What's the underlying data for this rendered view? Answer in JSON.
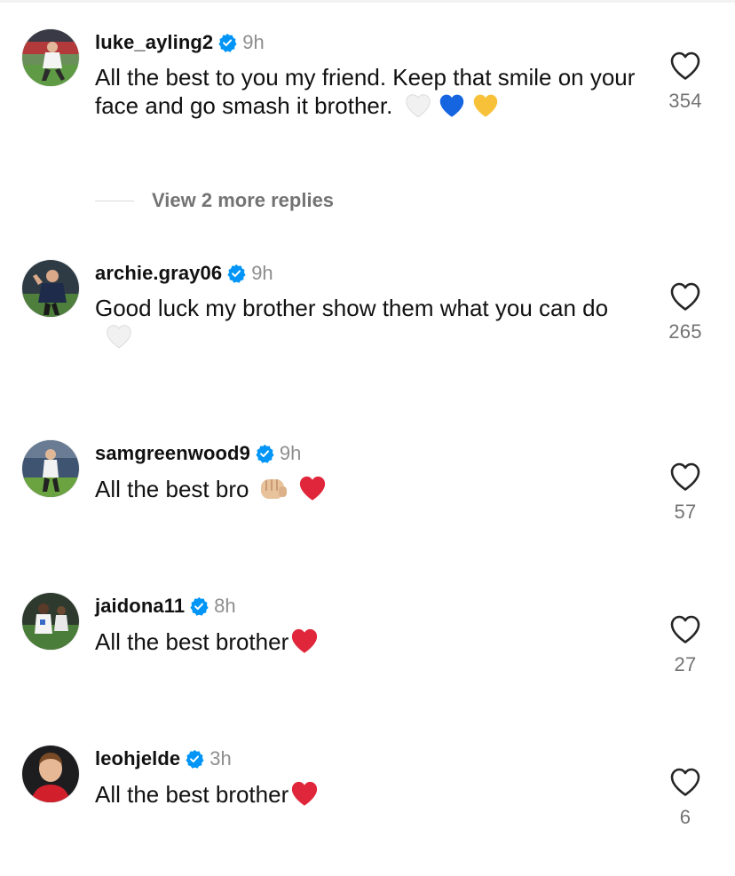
{
  "colors": {
    "verified_blue": "#0095f6",
    "muted_text": "#8e8e8e",
    "count_text": "#737373",
    "heart_red": "#e0263a"
  },
  "view_replies": {
    "label": "View 2 more replies"
  },
  "comments": [
    {
      "username": "luke_ayling2",
      "verified": true,
      "time": "9h",
      "text": "All the best to you my friend. Keep that smile on your face and go smash it brother.",
      "emojis": [
        "white-heart",
        "blue-heart",
        "yellow-heart"
      ],
      "likes": "354",
      "avatar_icon": "avatar-photo-icon"
    },
    {
      "username": "archie.gray06",
      "verified": true,
      "time": "9h",
      "text": "Good luck my brother show them what you can do",
      "emojis": [
        "white-heart"
      ],
      "likes": "265",
      "avatar_icon": "avatar-photo-icon"
    },
    {
      "username": "samgreenwood9",
      "verified": true,
      "time": "9h",
      "text": "All the best bro",
      "emojis": [
        "fist-bump",
        "red-heart"
      ],
      "likes": "57",
      "avatar_icon": "avatar-photo-icon"
    },
    {
      "username": "jaidona11",
      "verified": true,
      "time": "8h",
      "text": "All the best brother",
      "emojis": [
        "red-heart"
      ],
      "likes": "27",
      "avatar_icon": "avatar-photo-icon"
    },
    {
      "username": "leohjelde",
      "verified": true,
      "time": "3h",
      "text": "All the best brother",
      "emojis": [
        "red-heart"
      ],
      "likes": "6",
      "avatar_icon": "avatar-photo-icon"
    }
  ]
}
